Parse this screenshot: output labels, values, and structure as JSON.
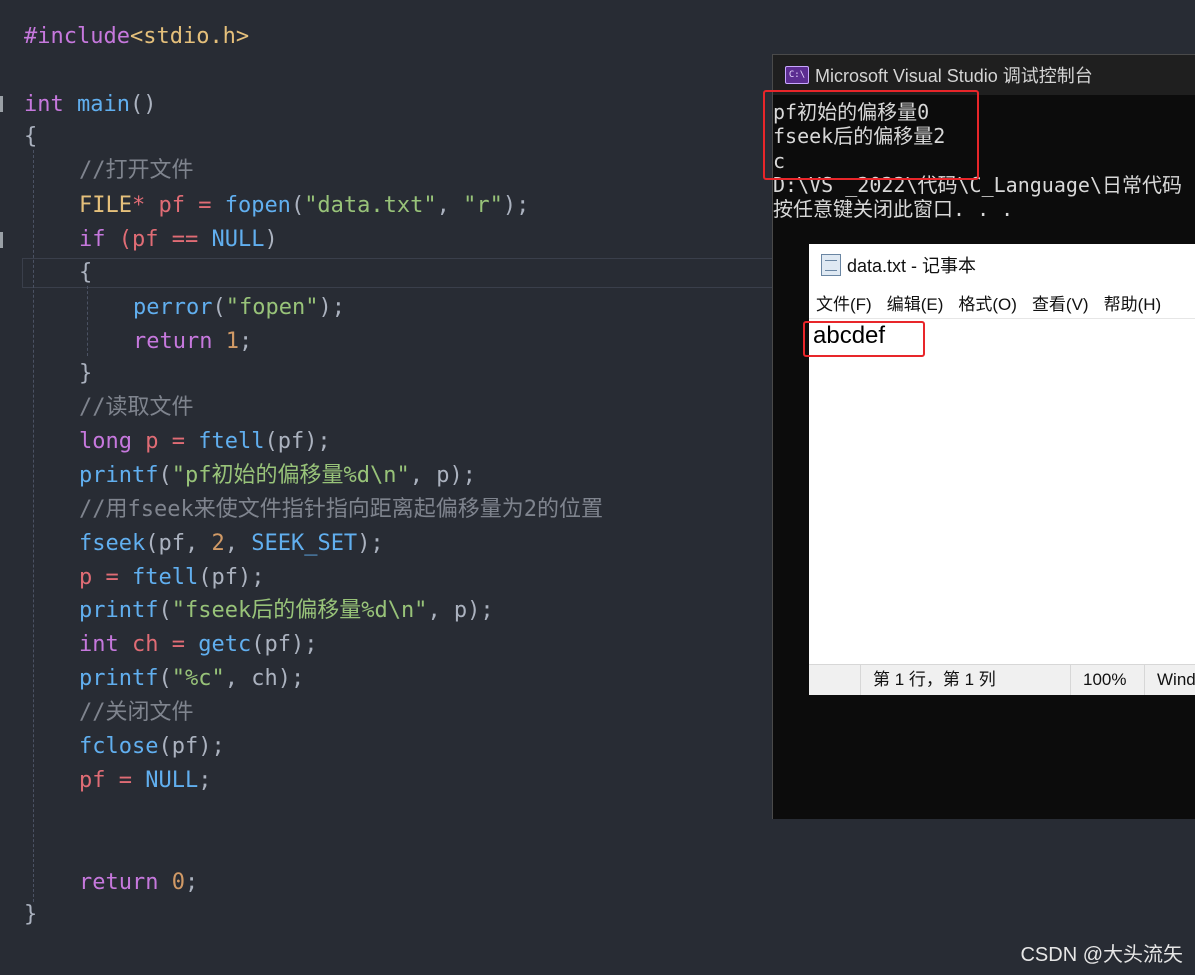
{
  "editor": {
    "include_directive": "#include",
    "include_header": "<stdio.h>",
    "int_kw": "int",
    "main_fn": "main",
    "main_parens": "()",
    "open_brace": "{",
    "close_brace": "}",
    "comment_open": "//打开文件",
    "line_fopen": {
      "type": "FILE",
      "ptr": "* pf = ",
      "fn": "fopen",
      "a": "(",
      "s1": "\"data.txt\"",
      "comma": ", ",
      "s2": "\"r\"",
      "end": ");"
    },
    "line_if": {
      "kw": "if",
      "rest": " (pf == ",
      "null": "NULL",
      "close": ")"
    },
    "inner_open": "{",
    "line_perror": {
      "fn": "perror",
      "a": "(",
      "s": "\"fopen\"",
      "end": ");"
    },
    "line_return1": {
      "kw": "return",
      "num": "1",
      "end": ";"
    },
    "inner_close": "}",
    "comment_read": "//读取文件",
    "line_ftell": {
      "kw": "long",
      "v": " p = ",
      "fn": "ftell",
      "rest": "(pf);"
    },
    "line_printf1": {
      "fn": "printf",
      "a": "(",
      "s": "\"pf初始的偏移量%d\\n\"",
      "rest": ", p);"
    },
    "comment_fseek": "//用fseek来使文件指针指向距离起偏移量为2的位置",
    "line_fseek": {
      "fn": "fseek",
      "a": "(pf, ",
      "num": "2",
      "b": ", ",
      "mac": "SEEK_SET",
      "end": ");"
    },
    "line_ftell2": {
      "v": "p = ",
      "fn": "ftell",
      "rest": "(pf);"
    },
    "line_printf2": {
      "fn": "printf",
      "a": "(",
      "s": "\"fseek后的偏移量%d\\n\"",
      "rest": ", p);"
    },
    "line_getc": {
      "kw": "int",
      "v": " ch = ",
      "fn": "getc",
      "rest": "(pf);"
    },
    "line_printf3": {
      "fn": "printf",
      "a": "(",
      "s": "\"%c\"",
      "rest": ", ch);"
    },
    "comment_close": "//关闭文件",
    "line_fclose": {
      "fn": "fclose",
      "rest": "(pf);"
    },
    "line_null": {
      "v": "pf = ",
      "null": "NULL",
      "end": ";"
    },
    "line_return0": {
      "kw": "return",
      "num": "0",
      "end": ";"
    }
  },
  "console": {
    "title": "Microsoft Visual Studio 调试控制台",
    "icon": "vs-console-icon",
    "icon_glyph": "C:\\",
    "lines": [
      "pf初始的偏移量0",
      "fseek后的偏移量2",
      "c",
      "D:\\VS _2022\\代码\\C_Language\\日常代码",
      "按任意键关闭此窗口. . ."
    ]
  },
  "notepad": {
    "title": "data.txt - 记事本",
    "icon": "notepad-icon",
    "menu": [
      "文件(F)",
      "编辑(E)",
      "格式(O)",
      "查看(V)",
      "帮助(H)"
    ],
    "content": "abcdef",
    "status": {
      "position": "第 1 行，第 1 列",
      "zoom": "100%",
      "encoding": "Wind"
    }
  },
  "watermark": "CSDN @大头流矢",
  "colors": {
    "editor_bg": "#282c34",
    "console_bg": "#0c0c0c",
    "highlight_box": "#e8262a"
  }
}
